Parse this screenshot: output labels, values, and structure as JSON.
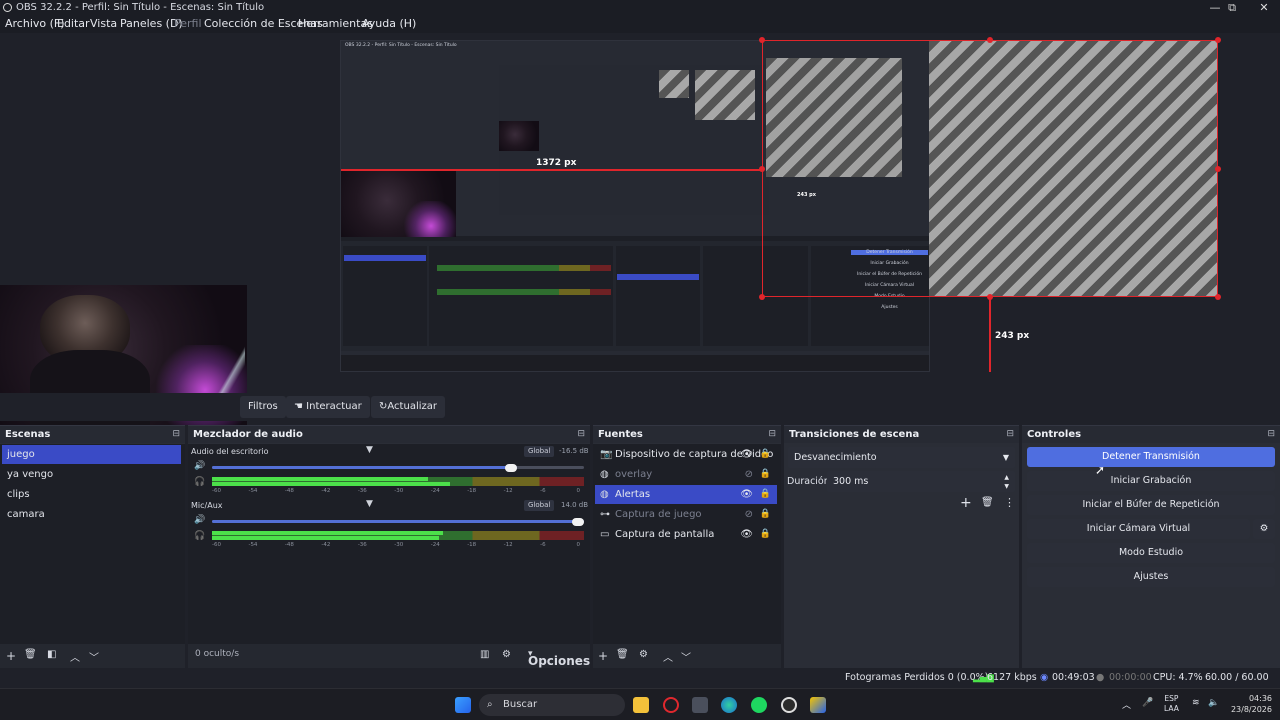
{
  "window": {
    "title": "OBS 32.2.2 - Perfil: Sin Título - Escenas: Sin Título",
    "minimize": "—",
    "maximize": "⧉",
    "close": "✕"
  },
  "menu": {
    "items": [
      "Archivo (F)",
      "Editar",
      "Vista",
      "Paneles (D)",
      "Perfil",
      "Colección de Escenas",
      "Herramientas",
      "Ayuda (H)"
    ]
  },
  "preview": {
    "measure_large": "243 px",
    "measure_wide": "1372 px",
    "measure_small": "243 px",
    "nested_title": "OBS 32.2.2 - Perfil: Sin Título - Escenas: Sin Título",
    "nested_controls": [
      "Detener Transmisión",
      "Iniciar Grabación",
      "Iniciar el Búfer de Repetición",
      "Iniciar Cámara Virtual",
      "Modo Estudio",
      "Ajustes"
    ]
  },
  "source_toolbar": {
    "filters": "Filtros",
    "interact": "Interactuar",
    "refresh": "Actualizar"
  },
  "scenes": {
    "title": "Escenas",
    "items": [
      "juego",
      "ya vengo",
      "clips",
      "camara"
    ],
    "selected": "juego"
  },
  "mixer": {
    "title": "Mezclador de audio",
    "channels": [
      {
        "name": "Audio del escritorio",
        "badge": "Global",
        "db": "-16.5 dB",
        "volume": 0.82
      },
      {
        "name": "Mic/Aux",
        "badge": "Global",
        "db": "14.0 dB",
        "volume": 1.0
      }
    ],
    "ticks": [
      "-60",
      "-54",
      "-48",
      "-42",
      "-36",
      "-30",
      "-24",
      "-18",
      "-12",
      "-6",
      "0"
    ],
    "footer": "0 oculto/s",
    "options": "Opciones"
  },
  "sources": {
    "title": "Fuentes",
    "items": [
      {
        "name": "Dispositivo de captura de video",
        "icon": "camera-icon",
        "glyph": "📷",
        "hidden": false,
        "selected": false
      },
      {
        "name": "overlay",
        "icon": "globe-icon",
        "glyph": "◍",
        "hidden": true,
        "selected": false
      },
      {
        "name": "Alertas",
        "icon": "globe-icon",
        "glyph": "◍",
        "hidden": false,
        "selected": true
      },
      {
        "name": "Captura de juego",
        "icon": "gamepad-icon",
        "glyph": "⊶",
        "hidden": true,
        "selected": false
      },
      {
        "name": "Captura de pantalla",
        "icon": "monitor-icon",
        "glyph": "▭",
        "hidden": false,
        "selected": false
      }
    ]
  },
  "transitions": {
    "title": "Transiciones de escena",
    "selected": "Desvanecimiento",
    "duration_label": "Duración",
    "duration_value": "300 ms"
  },
  "controls": {
    "title": "Controles",
    "buttons": [
      "Detener Transmisión",
      "Iniciar Grabación",
      "Iniciar el Búfer de Repetición",
      "Iniciar Cámara Virtual",
      "Modo Estudio",
      "Ajustes"
    ]
  },
  "status": {
    "dropped": "Fotogramas Perdidos 0 (0.0%)",
    "bitrate": "6127 kbps",
    "stream_time": "00:49:03",
    "rec_time": "00:00:00",
    "cpu": "CPU: 4.7%",
    "fps": "60.00 / 60.00 FPS"
  },
  "taskbar": {
    "search": "Buscar",
    "lang1": "ESP",
    "lang2": "LAA",
    "time": "04:36",
    "date": "23/8/2026"
  },
  "colors": {
    "accent": "#4f6ee0",
    "selection": "#3a4bc6",
    "guide_red": "#e0252b"
  }
}
